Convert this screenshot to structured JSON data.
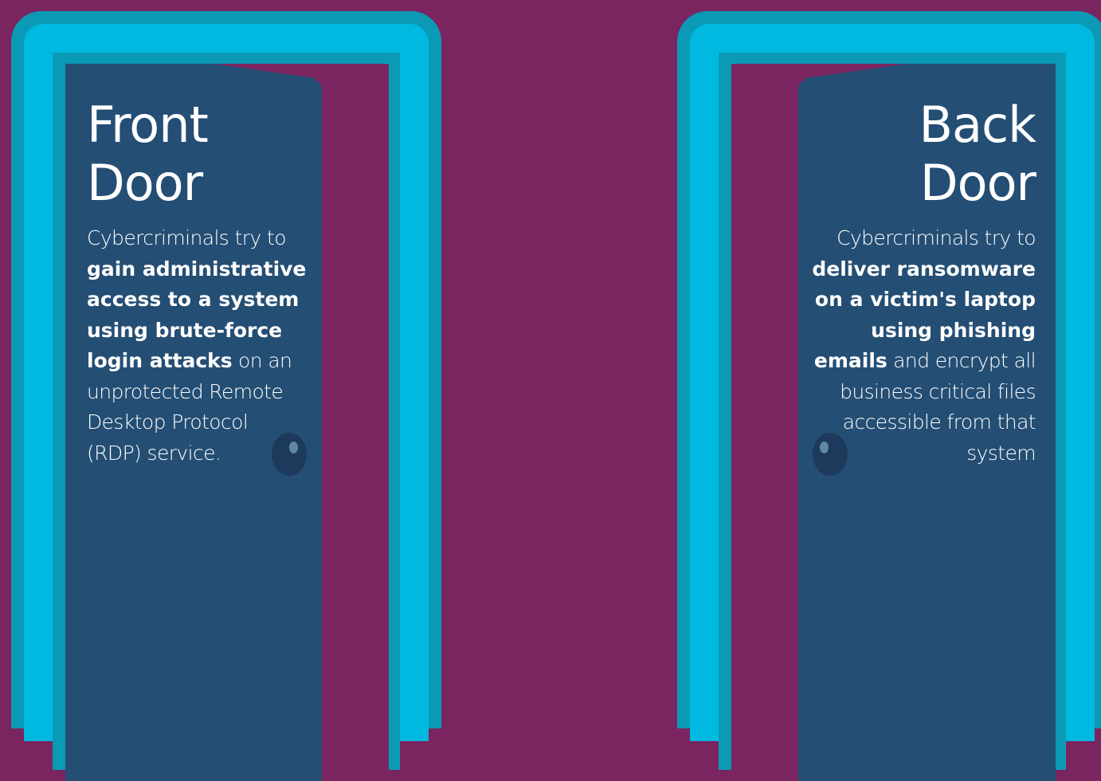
{
  "front_door": {
    "title_line1": "Front",
    "title_line2": "Door",
    "desc": {
      "l1": "Cybercriminals try to",
      "l2_bold": "gain administrative",
      "l3_bold": "access to a system",
      "l4_bold": "using brute-force",
      "l5_bold": "login attacks",
      "l5_light": " on an",
      "l6": "unprotected Remote",
      "l7": "Desktop Protocol",
      "l8": "(RDP) service."
    }
  },
  "back_door": {
    "title_line1": "Back",
    "title_line2": "Door",
    "desc": {
      "l1": "Cybercriminals try to",
      "l2_bold": "deliver ransomware",
      "l3_bold": "on a victim's laptop",
      "l4_bold": "using phishing",
      "l5_bold": "emails",
      "l5_light": " and encrypt all",
      "l6": "business critical files",
      "l7": "accessible from that",
      "l8": "system"
    }
  },
  "colors": {
    "background": "#7a2460",
    "frame_outer": "#0b9ab6",
    "frame_mid": "#00b9e0",
    "door_panel": "#244e74",
    "knob": "#1d3a5d"
  }
}
